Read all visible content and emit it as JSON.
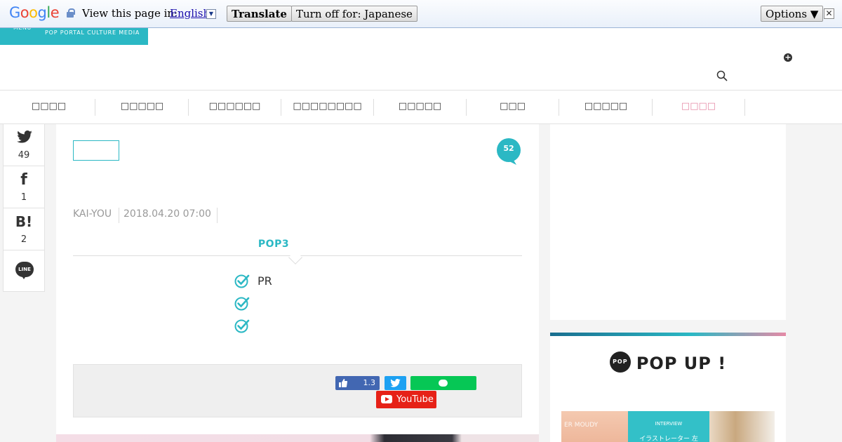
{
  "translate_bar": {
    "logo": "Google",
    "prompt": "View this page in:",
    "language": "English",
    "translate_label": "Translate",
    "turn_off_label": "Turn off for: Japanese",
    "options_label": "Options ▼",
    "close_glyph": "✕"
  },
  "header": {
    "menu_label": "MENU",
    "tagline": "POP PORTAL CULTURE MEDIA"
  },
  "nav": {
    "items": [
      {
        "label": "□□□□"
      },
      {
        "label": "□□□□□"
      },
      {
        "label": "□□□□□□"
      },
      {
        "label": "□□□□□□□□"
      },
      {
        "label": "□□□□□"
      },
      {
        "label": "□□□"
      },
      {
        "label": "□□□□□"
      },
      {
        "label": "□□□□"
      }
    ],
    "active_color": "#e58aa6"
  },
  "share_sidebar": {
    "twitter": {
      "icon": "twitter-icon",
      "count": "49"
    },
    "facebook": {
      "icon": "facebook-icon",
      "glyph": "f",
      "count": "1"
    },
    "hatena": {
      "icon": "hatena-icon",
      "glyph": "B!",
      "count": "2"
    },
    "line": {
      "icon": "line-icon",
      "glyph": "LINE"
    }
  },
  "article": {
    "comment_count": "52",
    "author": "KAI-YOU",
    "date": "2018.04.20 07:00",
    "pop3_heading": "POP3",
    "points": [
      "PR",
      "",
      ""
    ],
    "accent_color": "#2bb8c4"
  },
  "share_panel": {
    "like_count": "1.3",
    "youtube_label": "YouTube"
  },
  "popup": {
    "title": "POP UP !",
    "badge": "POP",
    "thumb_a_caption": "ER MOUDY",
    "thumb_b_line1": "INTERVIEW",
    "thumb_b_line2": "イラストレーター 左"
  }
}
